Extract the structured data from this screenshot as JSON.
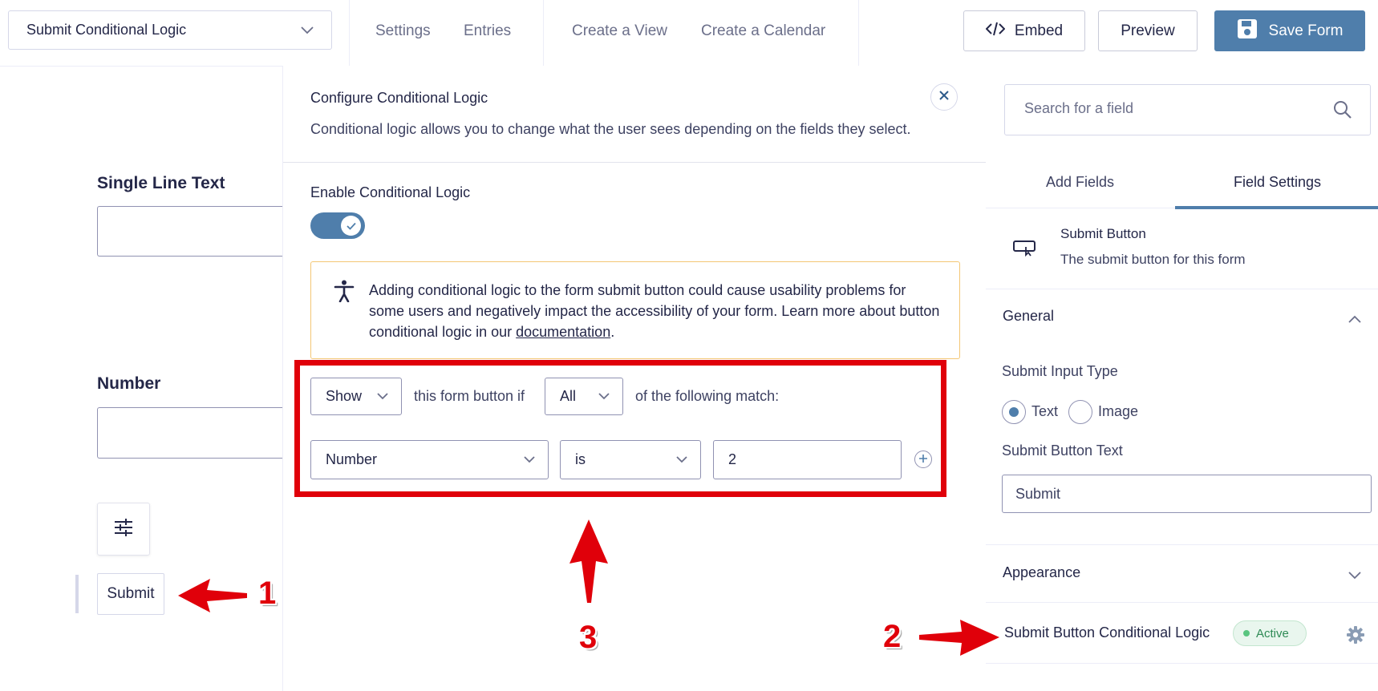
{
  "topbar": {
    "form_selector": "Submit Conditional Logic",
    "nav": [
      "Settings",
      "Entries",
      "Create a View",
      "Create a Calendar"
    ],
    "embed_label": "Embed",
    "preview_label": "Preview",
    "save_label": "Save Form"
  },
  "canvas": {
    "field1_label": "Single Line Text",
    "field2_label": "Number",
    "submit_label": "Submit"
  },
  "modal": {
    "title": "Configure Conditional Logic",
    "description": "Conditional logic allows you to change what the user sees depending on the fields they select.",
    "enable_label": "Enable Conditional Logic",
    "toggle_on": true,
    "warning_text": "Adding conditional logic to the form submit button could cause usability problems for some users and negatively impact the accessibility of your form. Learn more about button conditional logic in our ",
    "warning_link": "documentation",
    "warning_end": ".",
    "action_value": "Show",
    "text_mid": "this form button if",
    "match_value": "All",
    "text_end": "of the following match:",
    "rule_field": "Number",
    "rule_operator": "is",
    "rule_value": "2"
  },
  "sidebar": {
    "search_placeholder": "Search for a field",
    "tabs": [
      "Add Fields",
      "Field Settings"
    ],
    "active_tab": "Field Settings",
    "field_title": "Submit Button",
    "field_desc": "The submit button for this form",
    "general_label": "General",
    "input_type_label": "Submit Input Type",
    "radio_text": "Text",
    "radio_image": "Image",
    "button_text_label": "Submit Button Text",
    "button_text_value": "Submit",
    "appearance_label": "Appearance",
    "cond_logic_label": "Submit Button Conditional Logic",
    "active_badge": "Active"
  },
  "annotations": {
    "num1": "1",
    "num2": "2",
    "num3": "3",
    "color": "#e0000a"
  }
}
